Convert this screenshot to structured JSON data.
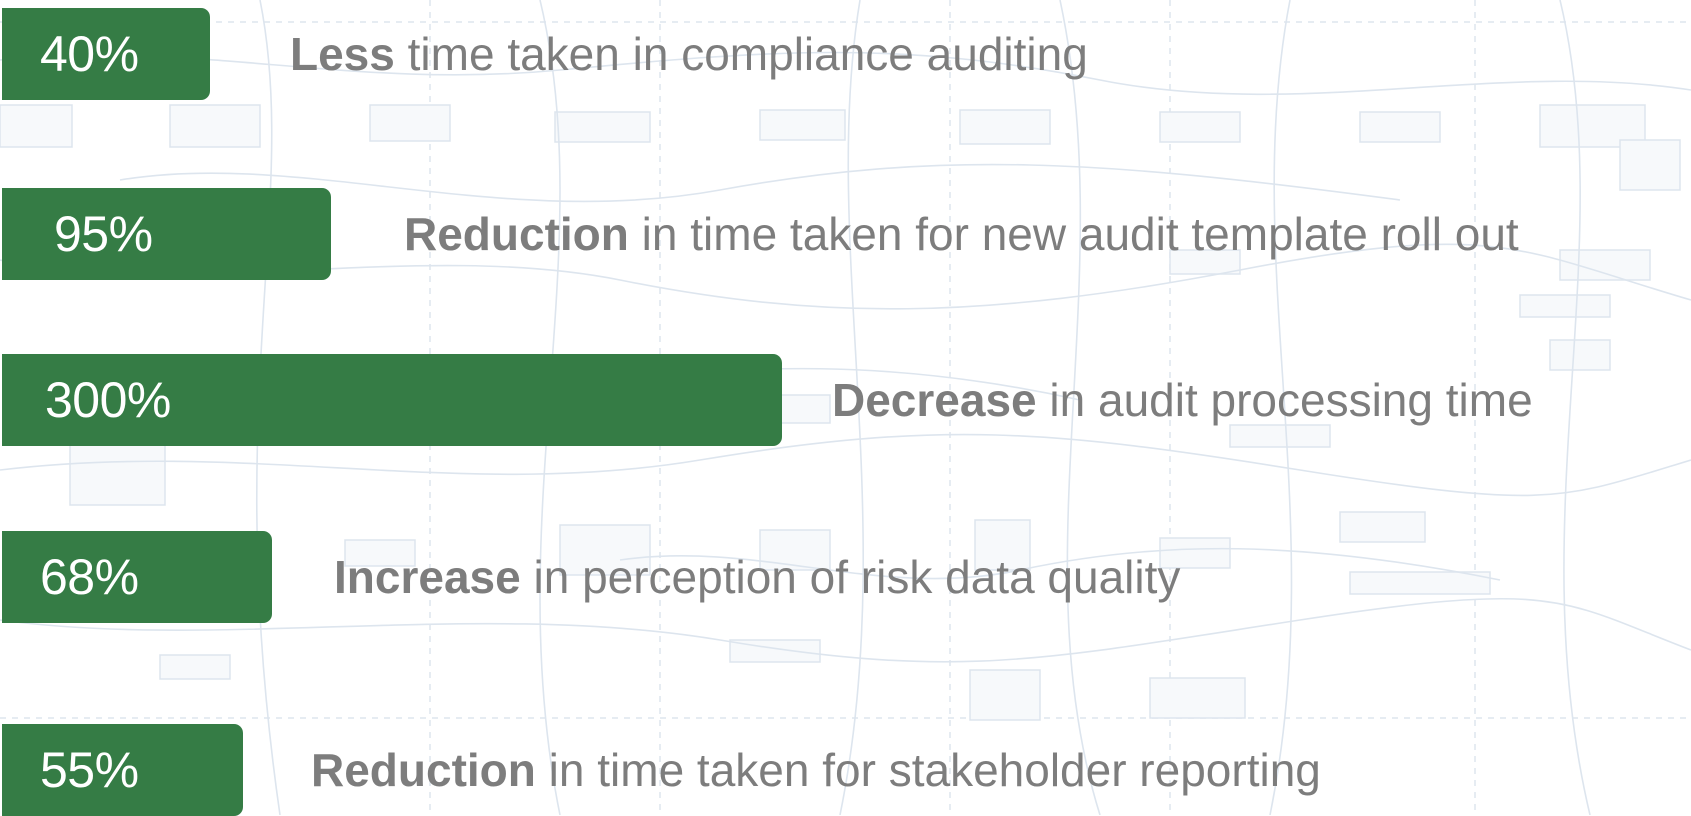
{
  "colors": {
    "bar": "#357c45",
    "value_text": "#ffffff",
    "caption_text": "#7d7d7d",
    "background": "#ffffff",
    "background_pattern": "#dde5ee"
  },
  "chart_data": {
    "type": "bar",
    "orientation": "horizontal",
    "unit": "%",
    "categories": [
      "Less time taken in compliance auditing",
      "Reduction in time taken for new audit template roll out",
      "Decrease in audit processing time",
      "Increase in perception of risk data quality",
      "Reduction in time taken for stakeholder reporting"
    ],
    "values": [
      40,
      95,
      300,
      68,
      55
    ],
    "grid": false,
    "legend": "none"
  },
  "metrics": [
    {
      "value_label": "40%",
      "lead": "Less",
      "rest": " time taken in compliance auditing"
    },
    {
      "value_label": "95%",
      "lead": "Reduction",
      "rest": " in time taken for new audit template roll out"
    },
    {
      "value_label": "300%",
      "lead": "Decrease",
      "rest": " in audit processing time"
    },
    {
      "value_label": "68%",
      "lead": "Increase",
      "rest": " in perception of risk data quality"
    },
    {
      "value_label": "55%",
      "lead": "Reduction",
      "rest": " in time taken for stakeholder reporting"
    }
  ]
}
